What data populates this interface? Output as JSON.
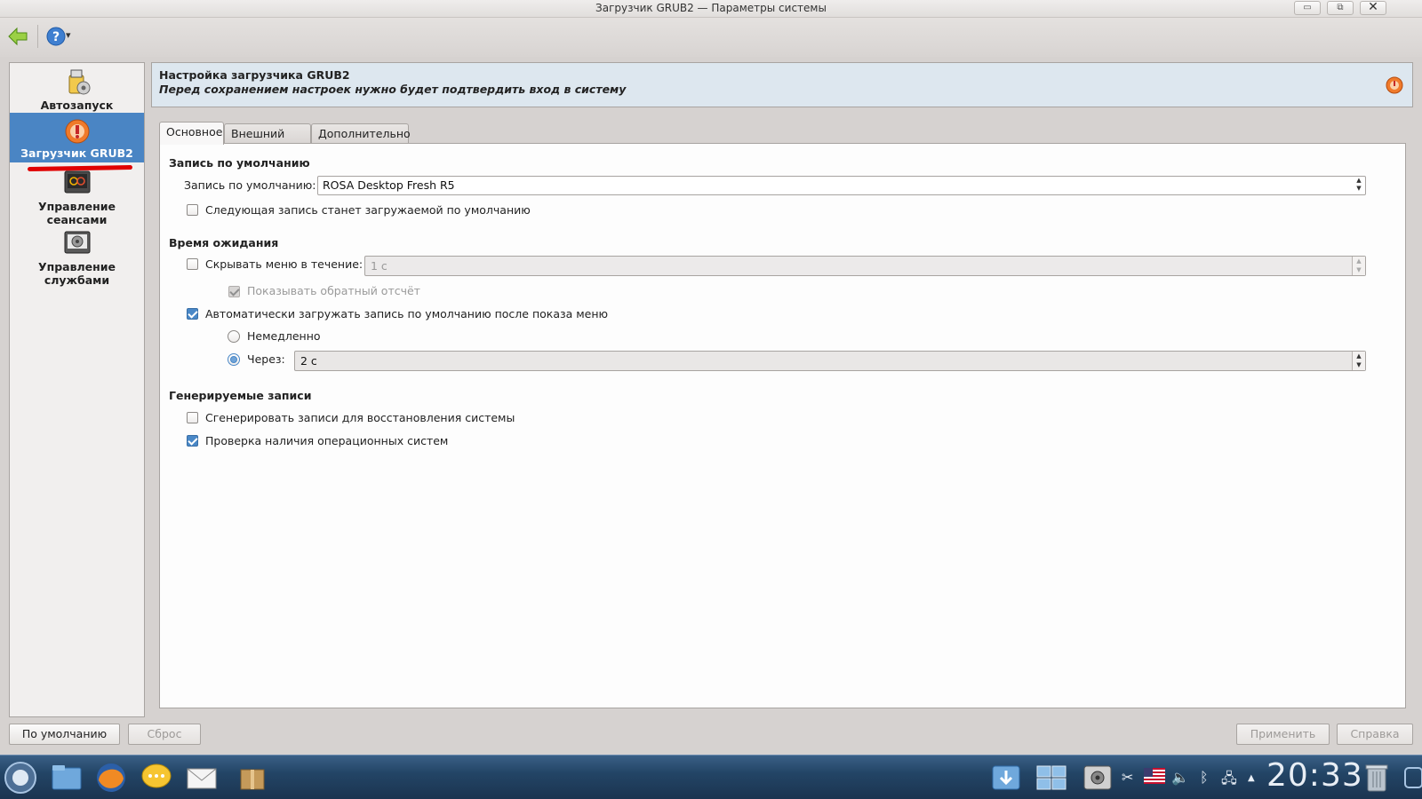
{
  "window": {
    "title": "Загрузчик GRUB2 — Параметры системы",
    "minimize": "▭",
    "restore": "⧉",
    "close": "✕"
  },
  "toolbar": {
    "back_icon": "back-arrow-icon",
    "help_icon": "help-icon",
    "help_label": "?",
    "help_dropdown": "▾"
  },
  "sidebar": {
    "items": [
      {
        "label": "Автозапуск",
        "icon": "autostart-icon",
        "active": false
      },
      {
        "label": "Загрузчик GRUB2",
        "icon": "grub-icon",
        "active": true
      },
      {
        "label": "Управление сеансами",
        "icon": "session-icon",
        "active": false
      },
      {
        "label": "Управление службами",
        "icon": "services-icon",
        "active": false
      }
    ]
  },
  "header": {
    "title": "Настройка загрузчика GRUB2",
    "subtitle": "Перед сохранением настроек нужно будет подтвердить вход в систему"
  },
  "tabs": [
    {
      "label": "Основное",
      "active": true
    },
    {
      "label": "Внешний вид",
      "active": false
    },
    {
      "label": "Дополнительно",
      "active": false
    }
  ],
  "main": {
    "default_section": {
      "heading": "Запись по умолчанию",
      "default_label": "Запись по умолчанию:",
      "default_value": "ROSA Desktop Fresh R5",
      "next_boot_label": "Следующая запись станет загружаемой по умолчанию",
      "next_boot_checked": false
    },
    "timeout_section": {
      "heading": "Время ожидания",
      "hide_menu_label": "Скрывать меню в течение:",
      "hide_menu_checked": false,
      "hide_menu_value": "1 с",
      "countdown_label": "Показывать обратный отсчёт",
      "countdown_checked": true,
      "auto_boot_label": "Автоматически загружать запись по умолчанию после показа меню",
      "auto_boot_checked": true,
      "immediately_label": "Немедленно",
      "after_label": "Через:",
      "after_value": "2 с"
    },
    "generated_section": {
      "heading": "Генерируемые записи",
      "recovery_label": "Сгенерировать записи для восстановления системы",
      "recovery_checked": false,
      "os_prober_label": "Проверка наличия операционных систем",
      "os_prober_checked": true
    }
  },
  "buttons": {
    "defaults": "По умолчанию",
    "reset": "Сброс",
    "apply": "Применить",
    "help": "Справка"
  },
  "taskbar": {
    "clock": "20:33",
    "tray": [
      "scissors-icon",
      "us-flag-icon",
      "volume-icon",
      "bluetooth-icon",
      "network-icon",
      "expand-tray-icon"
    ]
  },
  "colors": {
    "accent": "#4a85c4",
    "header_bg": "#dde7ef",
    "annotation_red": "#e00000",
    "taskbar": "#234566"
  }
}
